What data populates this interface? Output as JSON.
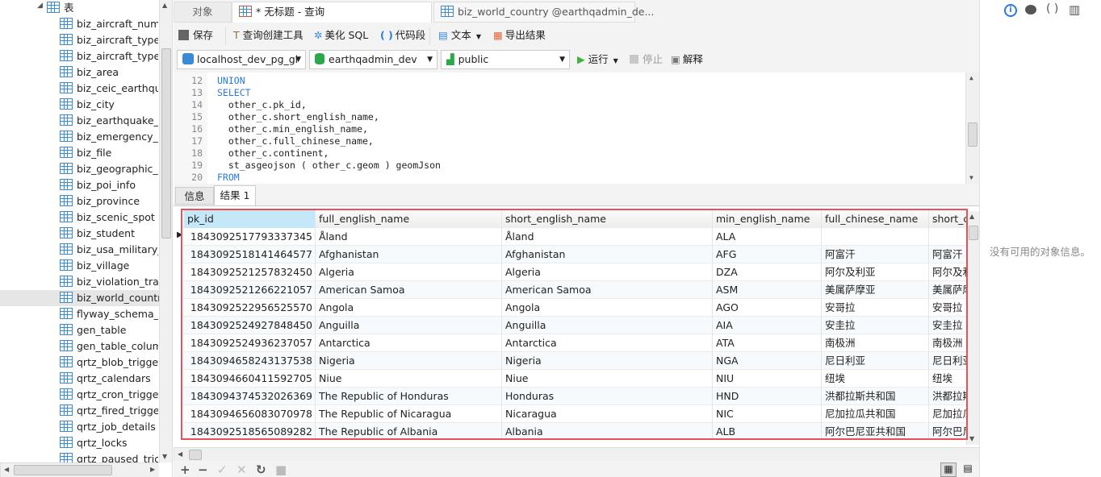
{
  "sidebar": {
    "group_label": "表",
    "items": [
      "biz_aircraft_numb",
      "biz_aircraft_type",
      "biz_aircraft_type_p",
      "biz_area",
      "biz_ceic_earthqua",
      "biz_city",
      "biz_earthquake_ir",
      "biz_emergency_cc",
      "biz_file",
      "biz_geographic_n",
      "biz_poi_info",
      "biz_province",
      "biz_scenic_spot",
      "biz_student",
      "biz_usa_military_b",
      "biz_village",
      "biz_violation_train",
      "biz_world_country",
      "flyway_schema_his",
      "gen_table",
      "gen_table_columr",
      "qrtz_blob_trigger",
      "qrtz_calendars",
      "qrtz_cron_triggers",
      "qrtz_fired_trigger",
      "qrtz_job_details",
      "qrtz_locks",
      "qrtz_paused_trigc"
    ],
    "selected": "biz_world_country"
  },
  "tabs": [
    {
      "label": "对象"
    },
    {
      "label": "* 无标题 - 查询"
    },
    {
      "label": "biz_world_country @earthqadmin_de..."
    }
  ],
  "toolbar": {
    "save": "保存",
    "query_builder": "查询创建工具",
    "beautify": "美化 SQL",
    "snippet": "代码段",
    "text": "文本",
    "export": "导出结果"
  },
  "connection": {
    "server": "localhost_dev_pg_gl",
    "database": "earthqadmin_dev",
    "schema": "public",
    "run": "运行",
    "stop": "停止",
    "explain": "解释"
  },
  "editor": {
    "lines": [
      {
        "n": "12",
        "text": "UNION",
        "kw": true
      },
      {
        "n": "13",
        "text": "SELECT",
        "kw": true
      },
      {
        "n": "14",
        "text": "  other_c.pk_id,"
      },
      {
        "n": "15",
        "text": "  other_c.short_english_name,"
      },
      {
        "n": "16",
        "text": "  other_c.min_english_name,"
      },
      {
        "n": "17",
        "text": "  other_c.full_chinese_name,"
      },
      {
        "n": "18",
        "text": "  other_c.continent,"
      },
      {
        "n": "19",
        "text": "  st_asgeojson ( other_c.geom ) geomJson"
      },
      {
        "n": "20",
        "text": "FROM",
        "kw": true
      }
    ]
  },
  "result_tabs": [
    {
      "label": "信息"
    },
    {
      "label": "结果 1"
    }
  ],
  "grid": {
    "columns": [
      "pk_id",
      "full_english_name",
      "short_english_name",
      "min_english_name",
      "full_chinese_name",
      "short_c"
    ],
    "rows": [
      [
        "1843092517793337345",
        "Åland",
        "Åland",
        "ALA",
        "",
        ""
      ],
      [
        "1843092518141464577",
        "Afghanistan",
        "Afghanistan",
        "AFG",
        "阿富汗",
        "阿富汗"
      ],
      [
        "1843092521257832450",
        "Algeria",
        "Algeria",
        "DZA",
        "阿尔及利亚",
        "阿尔及利"
      ],
      [
        "1843092521266221057",
        "American Samoa",
        "American Samoa",
        "ASM",
        "美属萨摩亚",
        "美属萨摩"
      ],
      [
        "1843092522956525570",
        "Angola",
        "Angola",
        "AGO",
        "安哥拉",
        "安哥拉"
      ],
      [
        "1843092524927848450",
        "Anguilla",
        "Anguilla",
        "AIA",
        "安圭拉",
        "安圭拉"
      ],
      [
        "1843092524936237057",
        "Antarctica",
        "Antarctica",
        "ATA",
        "南极洲",
        "南极洲"
      ],
      [
        "1843094658243137538",
        "Nigeria",
        "Nigeria",
        "NGA",
        "尼日利亚",
        "尼日利亚"
      ],
      [
        "1843094660411592705",
        "Niue",
        "Niue",
        "NIU",
        "纽埃",
        "纽埃"
      ],
      [
        "1843094374532026369",
        "The  Republic  of  Honduras",
        "Honduras",
        "HND",
        "洪都拉斯共和国",
        "洪都拉斯"
      ],
      [
        "1843094656083070978",
        "The Republic of Nicaragua",
        "Nicaragua",
        "NIC",
        "尼加拉瓜共和国",
        "尼加拉瓜"
      ],
      [
        "1843092518565089282",
        "The  Republic  of  Albania",
        "Albania",
        "ALB",
        "阿尔巴尼亚共和国",
        "阿尔巴尼"
      ]
    ]
  },
  "right_panel": {
    "empty_text": "没有可用的对象信息。"
  },
  "colors": {
    "accent": "#2a7ad6",
    "grid_border": "#e8505b",
    "header_selected": "#c5e8f8"
  }
}
